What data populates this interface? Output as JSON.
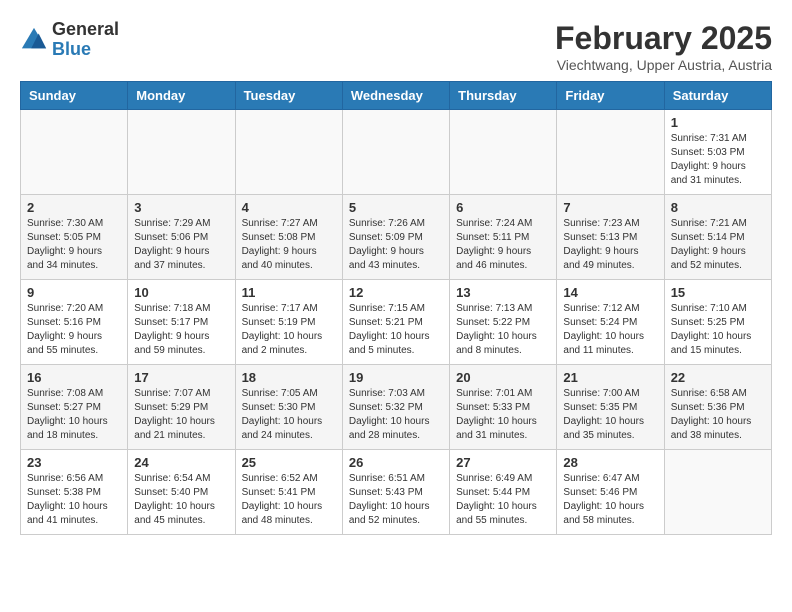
{
  "header": {
    "logo_general": "General",
    "logo_blue": "Blue",
    "month_title": "February 2025",
    "location": "Viechtwang, Upper Austria, Austria"
  },
  "weekdays": [
    "Sunday",
    "Monday",
    "Tuesday",
    "Wednesday",
    "Thursday",
    "Friday",
    "Saturday"
  ],
  "weeks": [
    [
      {
        "day": "",
        "info": ""
      },
      {
        "day": "",
        "info": ""
      },
      {
        "day": "",
        "info": ""
      },
      {
        "day": "",
        "info": ""
      },
      {
        "day": "",
        "info": ""
      },
      {
        "day": "",
        "info": ""
      },
      {
        "day": "1",
        "info": "Sunrise: 7:31 AM\nSunset: 5:03 PM\nDaylight: 9 hours and 31 minutes."
      }
    ],
    [
      {
        "day": "2",
        "info": "Sunrise: 7:30 AM\nSunset: 5:05 PM\nDaylight: 9 hours and 34 minutes."
      },
      {
        "day": "3",
        "info": "Sunrise: 7:29 AM\nSunset: 5:06 PM\nDaylight: 9 hours and 37 minutes."
      },
      {
        "day": "4",
        "info": "Sunrise: 7:27 AM\nSunset: 5:08 PM\nDaylight: 9 hours and 40 minutes."
      },
      {
        "day": "5",
        "info": "Sunrise: 7:26 AM\nSunset: 5:09 PM\nDaylight: 9 hours and 43 minutes."
      },
      {
        "day": "6",
        "info": "Sunrise: 7:24 AM\nSunset: 5:11 PM\nDaylight: 9 hours and 46 minutes."
      },
      {
        "day": "7",
        "info": "Sunrise: 7:23 AM\nSunset: 5:13 PM\nDaylight: 9 hours and 49 minutes."
      },
      {
        "day": "8",
        "info": "Sunrise: 7:21 AM\nSunset: 5:14 PM\nDaylight: 9 hours and 52 minutes."
      }
    ],
    [
      {
        "day": "9",
        "info": "Sunrise: 7:20 AM\nSunset: 5:16 PM\nDaylight: 9 hours and 55 minutes."
      },
      {
        "day": "10",
        "info": "Sunrise: 7:18 AM\nSunset: 5:17 PM\nDaylight: 9 hours and 59 minutes."
      },
      {
        "day": "11",
        "info": "Sunrise: 7:17 AM\nSunset: 5:19 PM\nDaylight: 10 hours and 2 minutes."
      },
      {
        "day": "12",
        "info": "Sunrise: 7:15 AM\nSunset: 5:21 PM\nDaylight: 10 hours and 5 minutes."
      },
      {
        "day": "13",
        "info": "Sunrise: 7:13 AM\nSunset: 5:22 PM\nDaylight: 10 hours and 8 minutes."
      },
      {
        "day": "14",
        "info": "Sunrise: 7:12 AM\nSunset: 5:24 PM\nDaylight: 10 hours and 11 minutes."
      },
      {
        "day": "15",
        "info": "Sunrise: 7:10 AM\nSunset: 5:25 PM\nDaylight: 10 hours and 15 minutes."
      }
    ],
    [
      {
        "day": "16",
        "info": "Sunrise: 7:08 AM\nSunset: 5:27 PM\nDaylight: 10 hours and 18 minutes."
      },
      {
        "day": "17",
        "info": "Sunrise: 7:07 AM\nSunset: 5:29 PM\nDaylight: 10 hours and 21 minutes."
      },
      {
        "day": "18",
        "info": "Sunrise: 7:05 AM\nSunset: 5:30 PM\nDaylight: 10 hours and 24 minutes."
      },
      {
        "day": "19",
        "info": "Sunrise: 7:03 AM\nSunset: 5:32 PM\nDaylight: 10 hours and 28 minutes."
      },
      {
        "day": "20",
        "info": "Sunrise: 7:01 AM\nSunset: 5:33 PM\nDaylight: 10 hours and 31 minutes."
      },
      {
        "day": "21",
        "info": "Sunrise: 7:00 AM\nSunset: 5:35 PM\nDaylight: 10 hours and 35 minutes."
      },
      {
        "day": "22",
        "info": "Sunrise: 6:58 AM\nSunset: 5:36 PM\nDaylight: 10 hours and 38 minutes."
      }
    ],
    [
      {
        "day": "23",
        "info": "Sunrise: 6:56 AM\nSunset: 5:38 PM\nDaylight: 10 hours and 41 minutes."
      },
      {
        "day": "24",
        "info": "Sunrise: 6:54 AM\nSunset: 5:40 PM\nDaylight: 10 hours and 45 minutes."
      },
      {
        "day": "25",
        "info": "Sunrise: 6:52 AM\nSunset: 5:41 PM\nDaylight: 10 hours and 48 minutes."
      },
      {
        "day": "26",
        "info": "Sunrise: 6:51 AM\nSunset: 5:43 PM\nDaylight: 10 hours and 52 minutes."
      },
      {
        "day": "27",
        "info": "Sunrise: 6:49 AM\nSunset: 5:44 PM\nDaylight: 10 hours and 55 minutes."
      },
      {
        "day": "28",
        "info": "Sunrise: 6:47 AM\nSunset: 5:46 PM\nDaylight: 10 hours and 58 minutes."
      },
      {
        "day": "",
        "info": ""
      }
    ]
  ]
}
